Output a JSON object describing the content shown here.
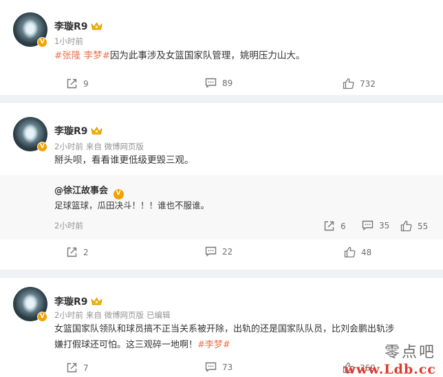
{
  "posts": [
    {
      "author": "李璇R9",
      "verified_badge": "V",
      "time": "1小时前",
      "source": "",
      "edited": "",
      "text_tags": "#张隆 李梦#",
      "text": "因为此事涉及女篮国家队管理，姚明压力山大。",
      "repost_count": "9",
      "comment_count": "89",
      "like_count": "732"
    },
    {
      "author": "李璇R9",
      "verified_badge": "V",
      "time": "2小时前",
      "source": "来自 微博网页版",
      "text": "掰头呗，看看谁更低级更毁三观。",
      "quoted": {
        "author": "@徐江故事会",
        "text": "足球篮球，瓜田决斗！！！谁也不服谁。",
        "time": "2小时前",
        "repost_count": "6",
        "comment_count": "35",
        "like_count": "55"
      },
      "repost_count": "2",
      "comment_count": "22",
      "like_count": "48"
    },
    {
      "author": "李璇R9",
      "verified_badge": "V",
      "time": "2小时前",
      "source": "来自 微博网页版",
      "edited": "已编辑",
      "text_line1": "女篮国家队领队和球员搞不正当关系被开除，出轨的还是国家队队员，比刘会鹏出轨涉",
      "text_line2": "嫌打假球还可怕。这三观碎一地啊！",
      "text_tag": "#李梦#",
      "repost_count": "7",
      "comment_count": "73",
      "like_count": "369"
    }
  ],
  "watermark": {
    "line1": "零点吧",
    "line2": "www.Ldb.cc"
  },
  "colors": {
    "tag": "#eb7350",
    "badge": "#f2a300",
    "meta": "#939393"
  },
  "icons": {
    "repost": "share-icon",
    "comment": "comment-icon",
    "like": "thumbs-up-icon",
    "crown": "crown-icon"
  }
}
